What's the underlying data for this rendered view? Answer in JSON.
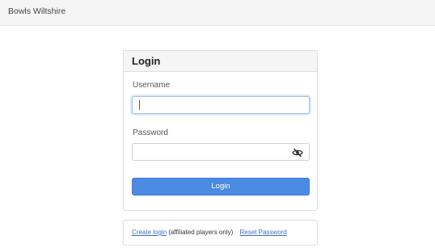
{
  "navbar": {
    "brand": "Bowls Wiltshire"
  },
  "login_panel": {
    "title": "Login",
    "username_label": "Username",
    "username_value": "",
    "password_label": "Password",
    "password_value": "",
    "password_toggle_icon": "eye-slash-icon",
    "submit_label": "Login"
  },
  "footer_links": {
    "create_login": "Create login",
    "create_note": "(affiliated players only)",
    "reset_password": "Reset Password"
  },
  "colors": {
    "primary": "#4a8ae0",
    "link": "#3a6fc4",
    "navbar_bg": "#f5f5f5"
  }
}
